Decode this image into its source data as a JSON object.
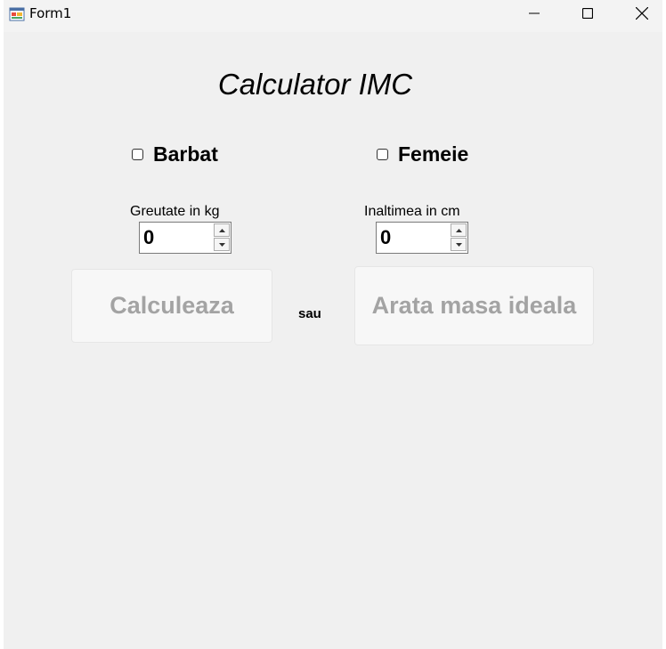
{
  "window": {
    "title": "Form1",
    "controls": {
      "minimize": "minimize-icon",
      "maximize": "maximize-icon",
      "close": "close-icon"
    }
  },
  "heading": "Calculator IMC",
  "gender": {
    "barbat": {
      "label": "Barbat",
      "checked": false
    },
    "femeie": {
      "label": "Femeie",
      "checked": false
    }
  },
  "fields": {
    "greutate": {
      "label": "Greutate in kg",
      "value": "0"
    },
    "inaltime": {
      "label": "Inaltimea in cm",
      "value": "0"
    }
  },
  "buttons": {
    "calculeaza": "Calculeaza",
    "separator": "sau",
    "arata": "Arata masa ideala"
  },
  "colors": {
    "form_background": "#f0f0f0",
    "disabled_button_text": "#a3a3a3"
  }
}
